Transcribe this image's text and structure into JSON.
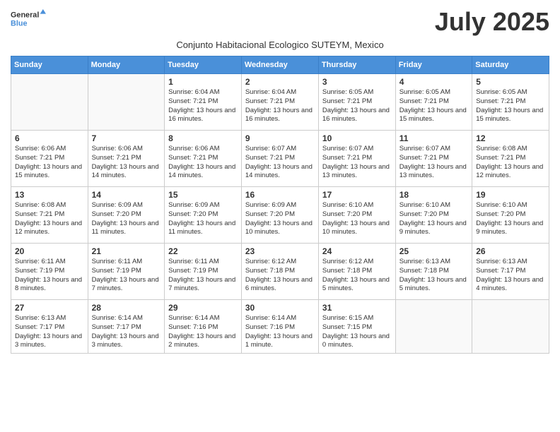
{
  "logo": {
    "general": "General",
    "blue": "Blue"
  },
  "title": "July 2025",
  "subtitle": "Conjunto Habitacional Ecologico SUTEYM, Mexico",
  "days_of_week": [
    "Sunday",
    "Monday",
    "Tuesday",
    "Wednesday",
    "Thursday",
    "Friday",
    "Saturday"
  ],
  "weeks": [
    [
      {
        "day": "",
        "info": ""
      },
      {
        "day": "",
        "info": ""
      },
      {
        "day": "1",
        "info": "Sunrise: 6:04 AM\nSunset: 7:21 PM\nDaylight: 13 hours and 16 minutes."
      },
      {
        "day": "2",
        "info": "Sunrise: 6:04 AM\nSunset: 7:21 PM\nDaylight: 13 hours and 16 minutes."
      },
      {
        "day": "3",
        "info": "Sunrise: 6:05 AM\nSunset: 7:21 PM\nDaylight: 13 hours and 16 minutes."
      },
      {
        "day": "4",
        "info": "Sunrise: 6:05 AM\nSunset: 7:21 PM\nDaylight: 13 hours and 15 minutes."
      },
      {
        "day": "5",
        "info": "Sunrise: 6:05 AM\nSunset: 7:21 PM\nDaylight: 13 hours and 15 minutes."
      }
    ],
    [
      {
        "day": "6",
        "info": "Sunrise: 6:06 AM\nSunset: 7:21 PM\nDaylight: 13 hours and 15 minutes."
      },
      {
        "day": "7",
        "info": "Sunrise: 6:06 AM\nSunset: 7:21 PM\nDaylight: 13 hours and 14 minutes."
      },
      {
        "day": "8",
        "info": "Sunrise: 6:06 AM\nSunset: 7:21 PM\nDaylight: 13 hours and 14 minutes."
      },
      {
        "day": "9",
        "info": "Sunrise: 6:07 AM\nSunset: 7:21 PM\nDaylight: 13 hours and 14 minutes."
      },
      {
        "day": "10",
        "info": "Sunrise: 6:07 AM\nSunset: 7:21 PM\nDaylight: 13 hours and 13 minutes."
      },
      {
        "day": "11",
        "info": "Sunrise: 6:07 AM\nSunset: 7:21 PM\nDaylight: 13 hours and 13 minutes."
      },
      {
        "day": "12",
        "info": "Sunrise: 6:08 AM\nSunset: 7:21 PM\nDaylight: 13 hours and 12 minutes."
      }
    ],
    [
      {
        "day": "13",
        "info": "Sunrise: 6:08 AM\nSunset: 7:21 PM\nDaylight: 13 hours and 12 minutes."
      },
      {
        "day": "14",
        "info": "Sunrise: 6:09 AM\nSunset: 7:20 PM\nDaylight: 13 hours and 11 minutes."
      },
      {
        "day": "15",
        "info": "Sunrise: 6:09 AM\nSunset: 7:20 PM\nDaylight: 13 hours and 11 minutes."
      },
      {
        "day": "16",
        "info": "Sunrise: 6:09 AM\nSunset: 7:20 PM\nDaylight: 13 hours and 10 minutes."
      },
      {
        "day": "17",
        "info": "Sunrise: 6:10 AM\nSunset: 7:20 PM\nDaylight: 13 hours and 10 minutes."
      },
      {
        "day": "18",
        "info": "Sunrise: 6:10 AM\nSunset: 7:20 PM\nDaylight: 13 hours and 9 minutes."
      },
      {
        "day": "19",
        "info": "Sunrise: 6:10 AM\nSunset: 7:20 PM\nDaylight: 13 hours and 9 minutes."
      }
    ],
    [
      {
        "day": "20",
        "info": "Sunrise: 6:11 AM\nSunset: 7:19 PM\nDaylight: 13 hours and 8 minutes."
      },
      {
        "day": "21",
        "info": "Sunrise: 6:11 AM\nSunset: 7:19 PM\nDaylight: 13 hours and 7 minutes."
      },
      {
        "day": "22",
        "info": "Sunrise: 6:11 AM\nSunset: 7:19 PM\nDaylight: 13 hours and 7 minutes."
      },
      {
        "day": "23",
        "info": "Sunrise: 6:12 AM\nSunset: 7:18 PM\nDaylight: 13 hours and 6 minutes."
      },
      {
        "day": "24",
        "info": "Sunrise: 6:12 AM\nSunset: 7:18 PM\nDaylight: 13 hours and 5 minutes."
      },
      {
        "day": "25",
        "info": "Sunrise: 6:13 AM\nSunset: 7:18 PM\nDaylight: 13 hours and 5 minutes."
      },
      {
        "day": "26",
        "info": "Sunrise: 6:13 AM\nSunset: 7:17 PM\nDaylight: 13 hours and 4 minutes."
      }
    ],
    [
      {
        "day": "27",
        "info": "Sunrise: 6:13 AM\nSunset: 7:17 PM\nDaylight: 13 hours and 3 minutes."
      },
      {
        "day": "28",
        "info": "Sunrise: 6:14 AM\nSunset: 7:17 PM\nDaylight: 13 hours and 3 minutes."
      },
      {
        "day": "29",
        "info": "Sunrise: 6:14 AM\nSunset: 7:16 PM\nDaylight: 13 hours and 2 minutes."
      },
      {
        "day": "30",
        "info": "Sunrise: 6:14 AM\nSunset: 7:16 PM\nDaylight: 13 hours and 1 minute."
      },
      {
        "day": "31",
        "info": "Sunrise: 6:15 AM\nSunset: 7:15 PM\nDaylight: 13 hours and 0 minutes."
      },
      {
        "day": "",
        "info": ""
      },
      {
        "day": "",
        "info": ""
      }
    ]
  ]
}
